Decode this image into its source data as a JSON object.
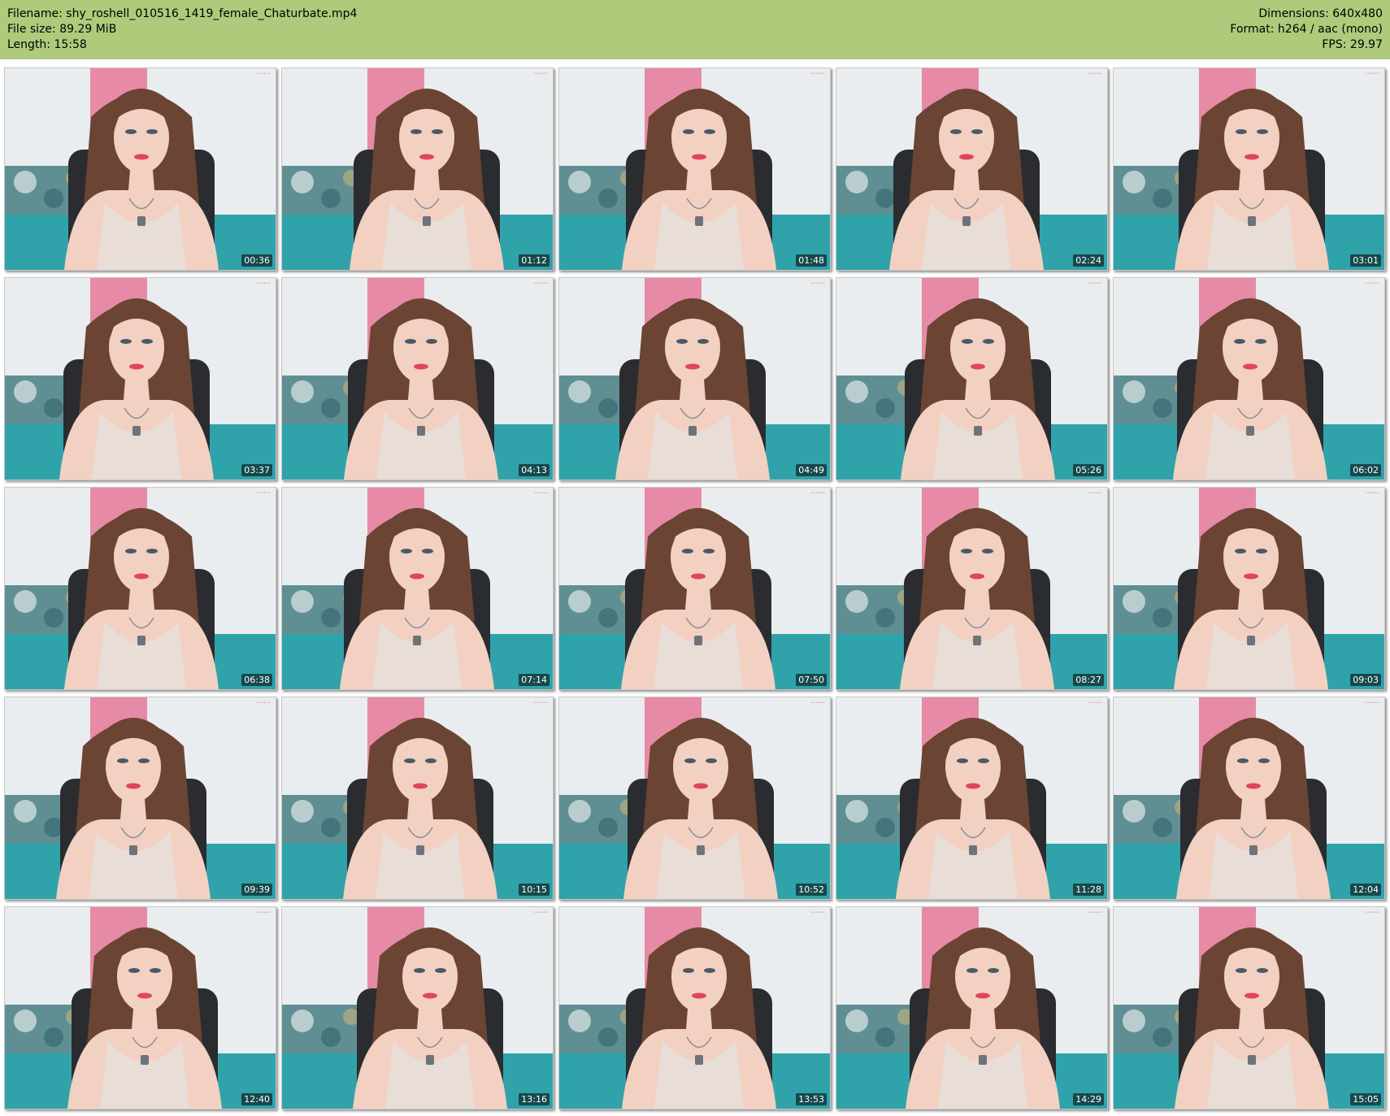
{
  "info": {
    "filename": "Filename: shy_roshell_010516_1419_female_Chaturbate.mp4",
    "filesize": "File size: 89.29 MiB",
    "length": "Length: 15:58",
    "dimensions": "Dimensions: 640x480",
    "format": "Format: h264 / aac (mono)",
    "fps": "FPS: 29.97"
  },
  "colors": {
    "header_bg": "#aecb7b",
    "wall": "#e9edef",
    "poster": "#e68aa6",
    "couch": "#2fa3a9",
    "chair": "#2a2c30",
    "hair": "#6b4433",
    "skin": "#f2d1c2",
    "top": "#e9ddd8"
  },
  "thumbnails": [
    {
      "time": "00:36"
    },
    {
      "time": "01:12"
    },
    {
      "time": "01:48"
    },
    {
      "time": "02:24"
    },
    {
      "time": "03:01"
    },
    {
      "time": "03:37"
    },
    {
      "time": "04:13"
    },
    {
      "time": "04:49"
    },
    {
      "time": "05:26"
    },
    {
      "time": "06:02"
    },
    {
      "time": "06:38"
    },
    {
      "time": "07:14"
    },
    {
      "time": "07:50"
    },
    {
      "time": "08:27"
    },
    {
      "time": "09:03"
    },
    {
      "time": "09:39"
    },
    {
      "time": "10:15"
    },
    {
      "time": "10:52"
    },
    {
      "time": "11:28"
    },
    {
      "time": "12:04"
    },
    {
      "time": "12:40"
    },
    {
      "time": "13:16"
    },
    {
      "time": "13:53"
    },
    {
      "time": "14:29"
    },
    {
      "time": "15:05"
    }
  ]
}
